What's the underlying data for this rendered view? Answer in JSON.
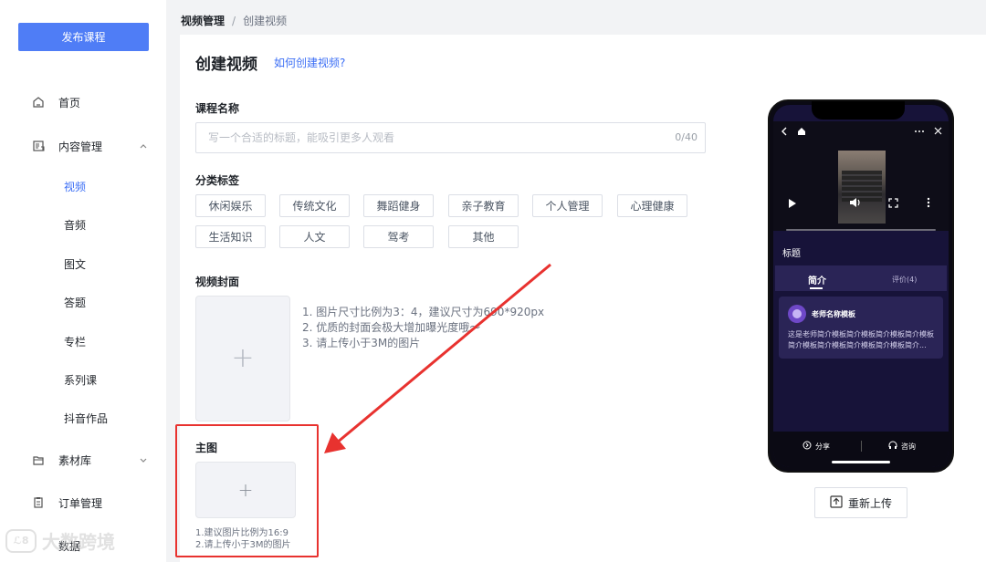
{
  "sidebar": {
    "publish_label": "发布课程",
    "items": [
      {
        "label": "首页",
        "icon": "home-icon"
      },
      {
        "label": "内容管理",
        "icon": "content-icon",
        "expanded": true
      },
      {
        "label": "素材库",
        "icon": "folder-icon",
        "expanded": false
      },
      {
        "label": "订单管理",
        "icon": "order-icon"
      }
    ],
    "sub_items": [
      {
        "label": "视频",
        "active": true
      },
      {
        "label": "音频"
      },
      {
        "label": "图文"
      },
      {
        "label": "答题"
      },
      {
        "label": "专栏"
      },
      {
        "label": "系列课"
      },
      {
        "label": "抖音作品"
      }
    ],
    "partial_item": "数据"
  },
  "breadcrumb": {
    "first": "视频管理",
    "separator": "/",
    "current": "创建视频"
  },
  "main": {
    "title": "创建视频",
    "help_link": "如何创建视频?",
    "course_name": {
      "label": "课程名称",
      "placeholder": "写一个合适的标题，能吸引更多人观看",
      "count": "0/40"
    },
    "tags": {
      "label": "分类标签",
      "items": [
        "休闲娱乐",
        "传统文化",
        "舞蹈健身",
        "亲子教育",
        "个人管理",
        "心理健康",
        "生活知识",
        "人文",
        "驾考",
        "其他"
      ]
    },
    "cover": {
      "label": "视频封面",
      "tips": [
        "1. 图片尺寸比例为3：4，建议尺寸为690*920px",
        "2. 优质的封面会极大增加曝光度哦～",
        "3. 请上传小于3M的图片"
      ]
    },
    "main_image": {
      "label": "主图",
      "tips": [
        "1.建议图片比例为16:9",
        "2.请上传小于3M的图片"
      ]
    }
  },
  "preview": {
    "title": "标题",
    "tab_intro": "简介",
    "tab_reviews": "评价(4)",
    "teacher_name": "老师名称模板",
    "desc_line1": "这是老师简介模板简介模板简介模板简介模板",
    "desc_line2": "简介模板简介模板简介模板简介模板简介...",
    "share": "分享",
    "consult": "咨询",
    "reupload": "重新上传"
  },
  "watermark": "大数跨境",
  "colors": {
    "primary": "#4f7df6",
    "link": "#3b6ef5",
    "annotation_red": "#e8322f",
    "phone_bg": "#171339"
  }
}
